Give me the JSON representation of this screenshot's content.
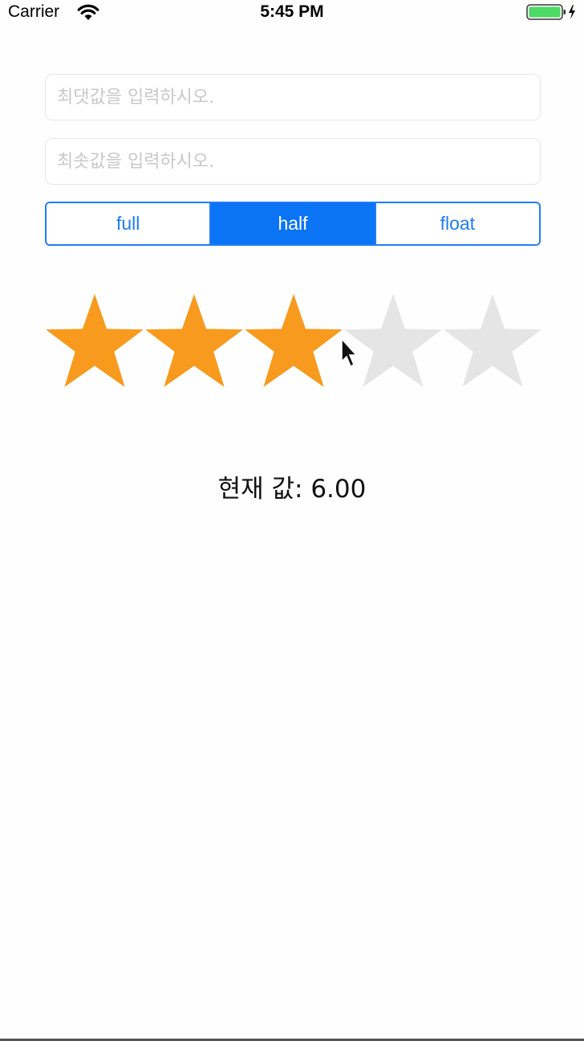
{
  "status_bar": {
    "carrier": "Carrier",
    "time": "5:45 PM",
    "icons": [
      "wifi-icon",
      "battery-icon",
      "charging-bolt-icon"
    ],
    "battery_color": "#4cd964"
  },
  "form": {
    "max_placeholder": "최댓값을 입력하시오.",
    "min_placeholder": "최솟값을 입력하시오.",
    "max_value": "",
    "min_value": ""
  },
  "segmented_control": {
    "segments": [
      "full",
      "half",
      "float"
    ],
    "selected": "half",
    "accent_color": "#0a74f5"
  },
  "rating": {
    "star_count": 5,
    "filled_stars": 3,
    "filled_color": "#f89a1d",
    "empty_color": "#e5e5e5",
    "icon": "star-icon"
  },
  "result": {
    "text": "현재 값: 6.00"
  }
}
